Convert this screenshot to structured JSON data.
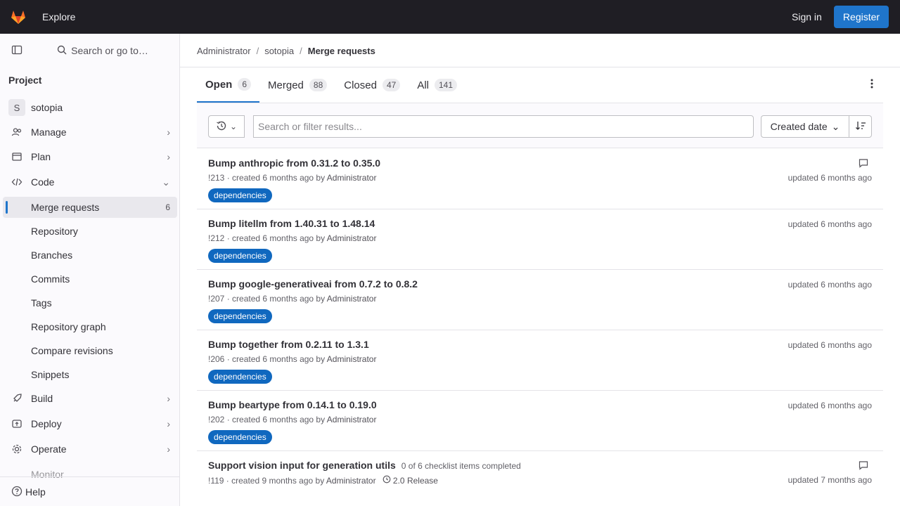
{
  "topbar": {
    "explore": "Explore",
    "signin": "Sign in",
    "register": "Register"
  },
  "sidebar": {
    "search_label": "Search or go to…",
    "heading": "Project",
    "project_initial": "S",
    "project_name": "sotopia",
    "items": [
      {
        "label": "Manage"
      },
      {
        "label": "Plan"
      },
      {
        "label": "Code"
      },
      {
        "label": "Merge requests",
        "count": "6"
      },
      {
        "label": "Repository"
      },
      {
        "label": "Branches"
      },
      {
        "label": "Commits"
      },
      {
        "label": "Tags"
      },
      {
        "label": "Repository graph"
      },
      {
        "label": "Compare revisions"
      },
      {
        "label": "Snippets"
      },
      {
        "label": "Build"
      },
      {
        "label": "Deploy"
      },
      {
        "label": "Operate"
      },
      {
        "label": "Monitor"
      }
    ],
    "help": "Help"
  },
  "breadcrumb": {
    "owner": "Administrator",
    "project": "sotopia",
    "current": "Merge requests"
  },
  "tabs": [
    {
      "label": "Open",
      "count": "6"
    },
    {
      "label": "Merged",
      "count": "88"
    },
    {
      "label": "Closed",
      "count": "47"
    },
    {
      "label": "All",
      "count": "141"
    }
  ],
  "filter": {
    "placeholder": "Search or filter results...",
    "sort": "Created date"
  },
  "merge_requests": [
    {
      "title": "Bump anthropic from 0.31.2 to 0.35.0",
      "meta": "!213 · created 6 months ago by ",
      "author": "Administrator",
      "label": "dependencies",
      "updated": "updated 6 months ago"
    },
    {
      "title": "Bump litellm from 1.40.31 to 1.48.14",
      "meta": "!212 · created 6 months ago by ",
      "author": "Administrator",
      "label": "dependencies",
      "updated": "updated 6 months ago"
    },
    {
      "title": "Bump google-generativeai from 0.7.2 to 0.8.2",
      "meta": "!207 · created 6 months ago by ",
      "author": "Administrator",
      "label": "dependencies",
      "updated": "updated 6 months ago"
    },
    {
      "title": "Bump together from 0.2.11 to 1.3.1",
      "meta": "!206 · created 6 months ago by ",
      "author": "Administrator",
      "label": "dependencies",
      "updated": "updated 6 months ago"
    },
    {
      "title": "Bump beartype from 0.14.1 to 0.19.0",
      "meta": "!202 · created 6 months ago by ",
      "author": "Administrator",
      "label": "dependencies",
      "updated": "updated 6 months ago"
    },
    {
      "title": "Support vision input for generation utils",
      "extra": "0 of 6 checklist items completed",
      "meta": "!119 · created 9 months ago by ",
      "author": "Administrator",
      "milestone": "2.0 Release",
      "updated": "updated 7 months ago"
    }
  ],
  "colors": {
    "topbar": "#1f1e24",
    "primary": "#1f75cb",
    "label": "#1068bf"
  }
}
